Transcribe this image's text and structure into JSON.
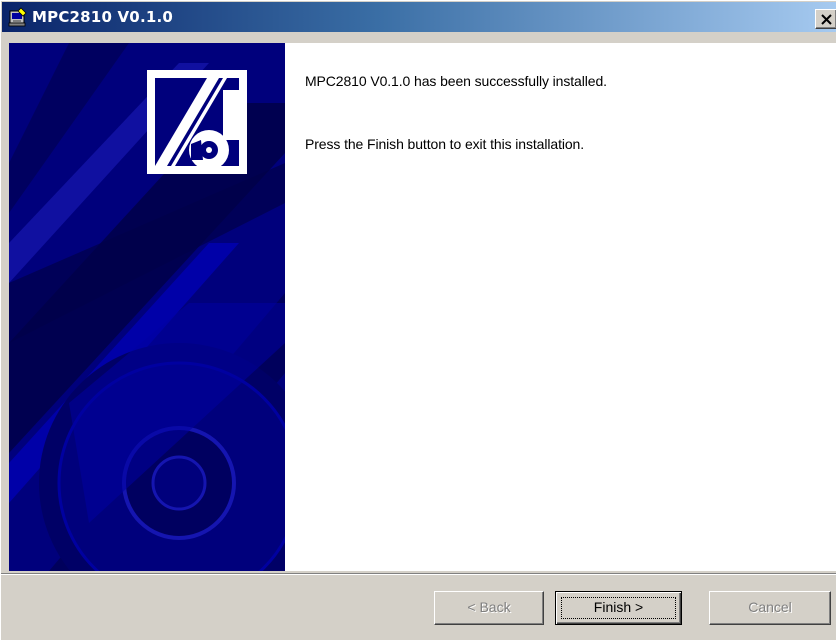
{
  "window": {
    "title": "MPC2810 V0.1.0",
    "close_glyph": "✕"
  },
  "content": {
    "line1": "MPC2810 V0.1.0 has been successfully installed.",
    "line2": "Press the Finish button to exit this installation."
  },
  "buttons": {
    "back": "< Back",
    "finish": "Finish >",
    "cancel": "Cancel"
  },
  "colors": {
    "banner_blue": "#00007c",
    "title_start": "#0a246a",
    "title_end": "#a6caf0",
    "face": "#d4d0c8"
  },
  "icons": {
    "title": "installer-icon",
    "logo": "install-logo-icon",
    "close": "close-icon"
  }
}
